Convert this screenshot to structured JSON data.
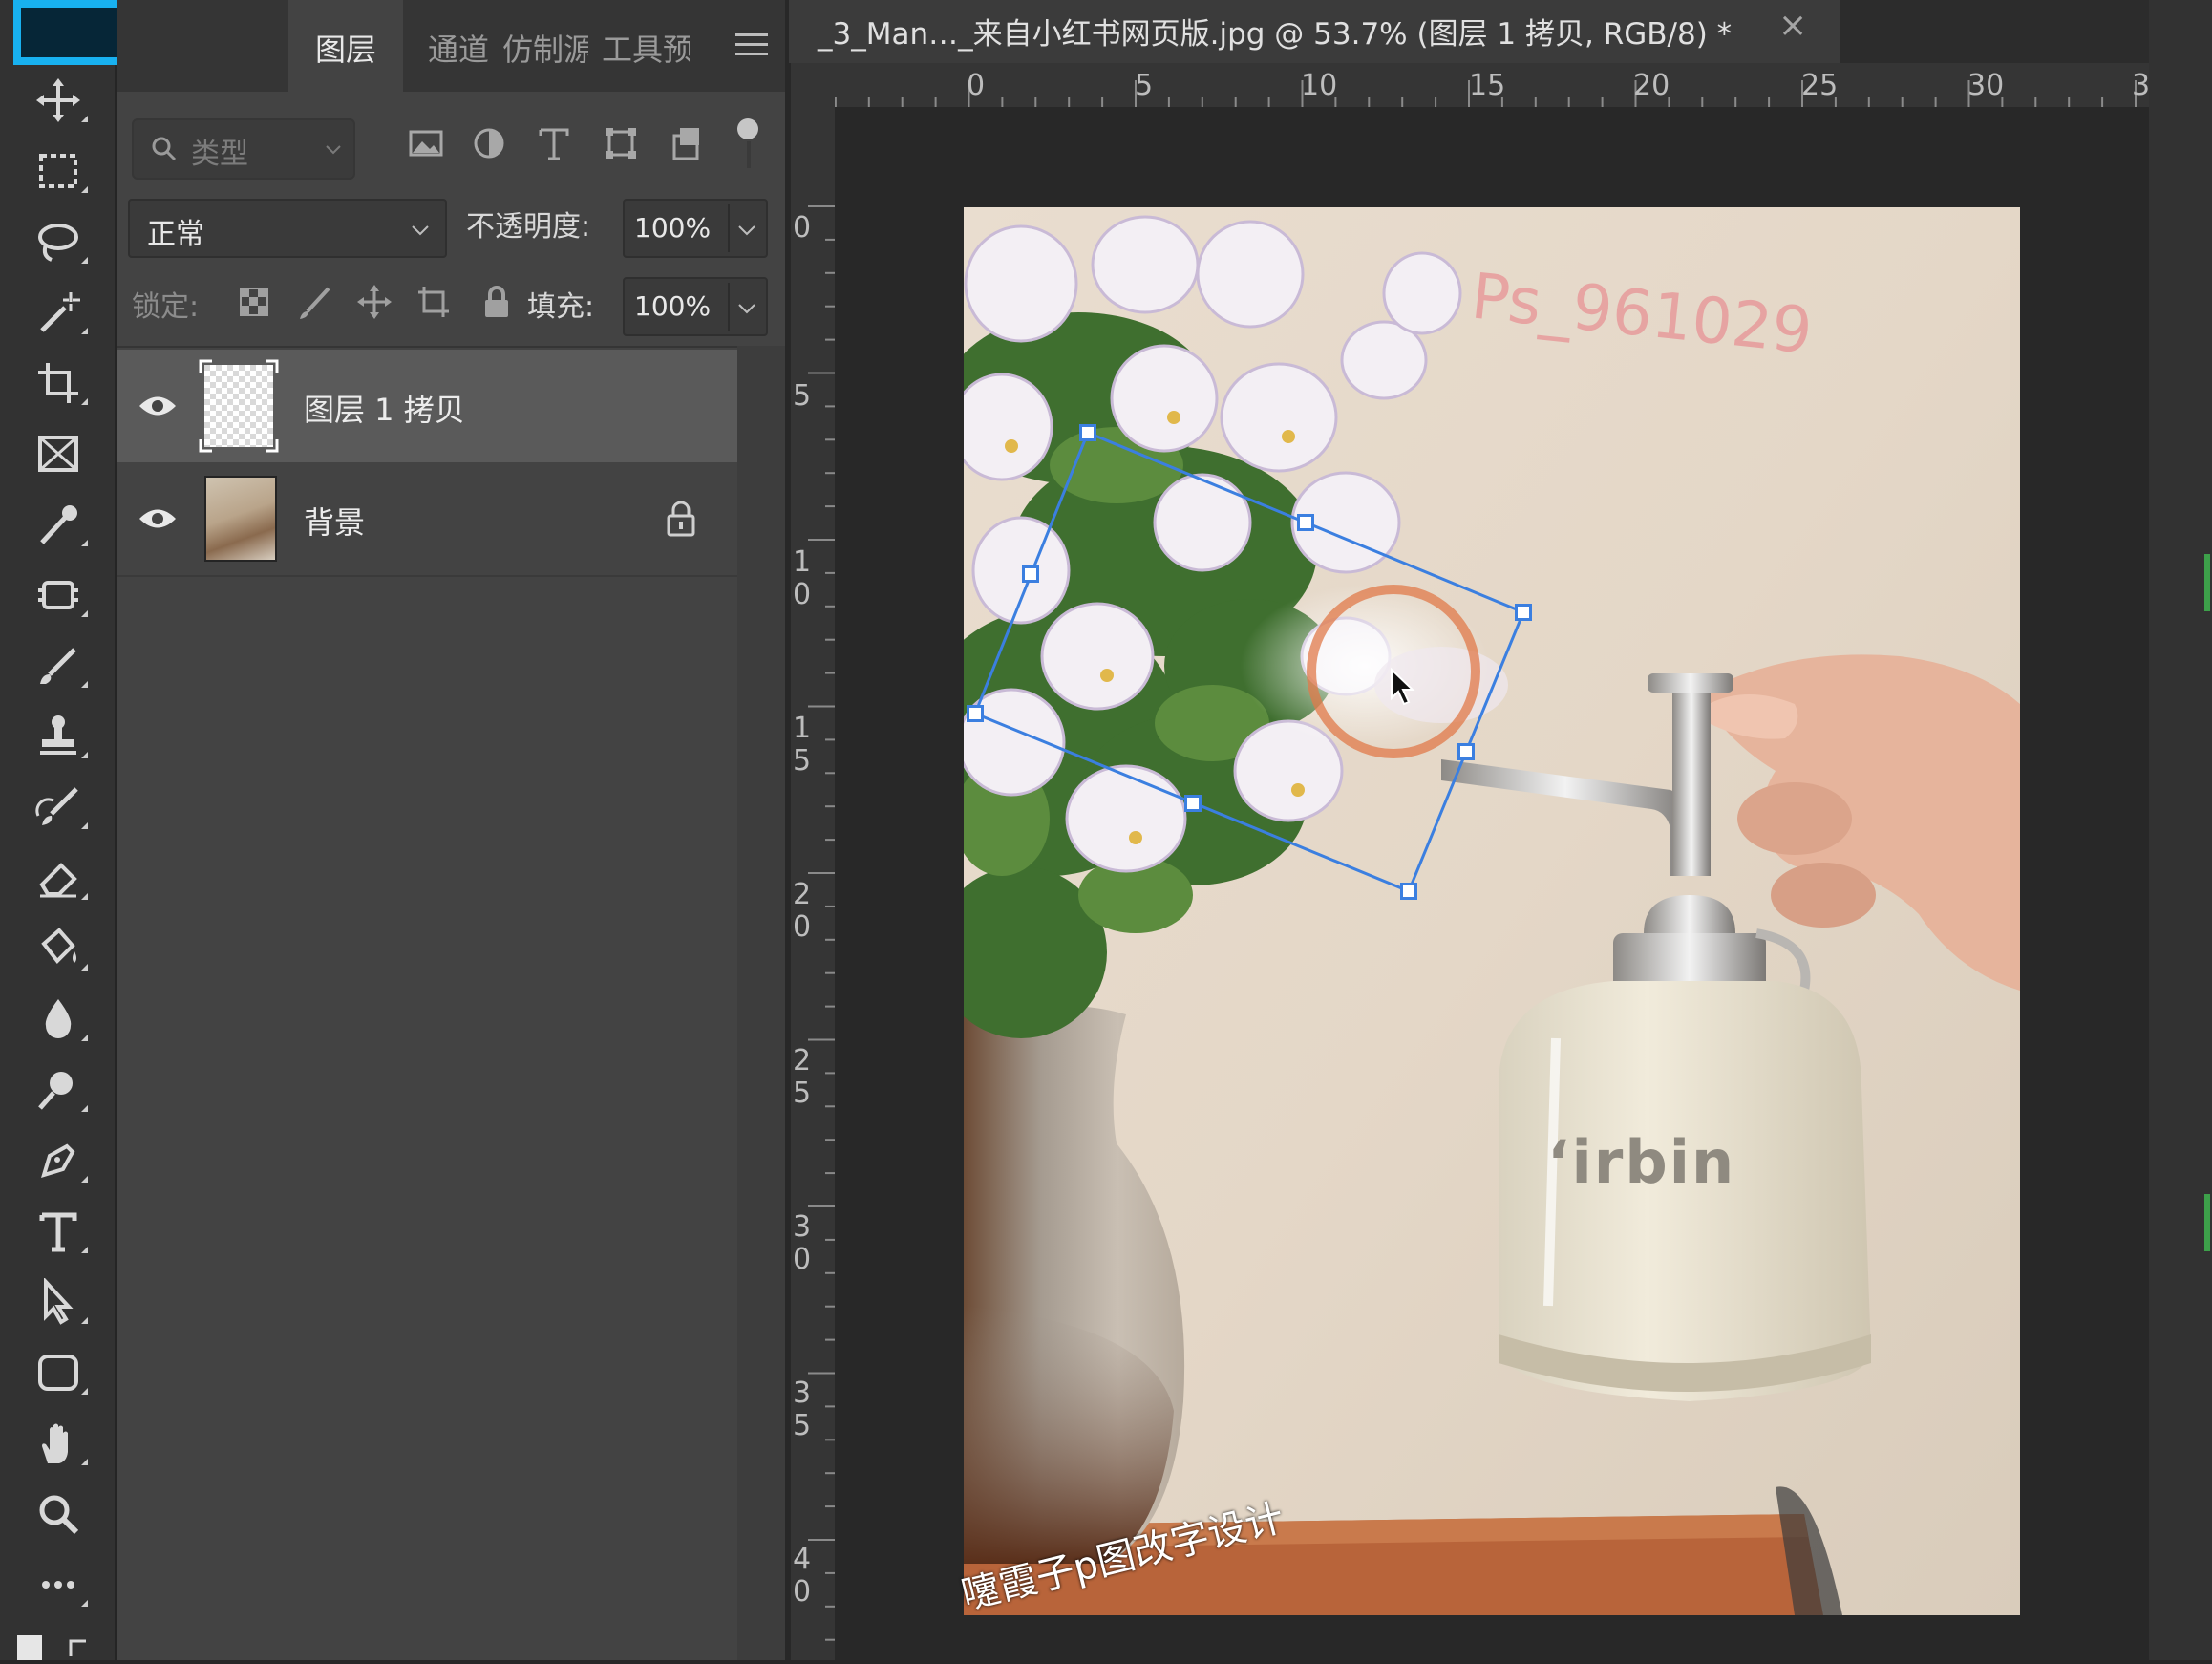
{
  "document": {
    "title": "_3_Man…_来自小红书网页版.jpg @ 53.7% (图层 1 拷贝, RGB/8) *",
    "close_icon": "×"
  },
  "colors": {
    "foreground_swatch_border": "#18b1f0",
    "foreground_swatch_fill": "#062637",
    "selection_handle": "#3b7fe0",
    "brush_cursor": "#e07a4a"
  },
  "panel": {
    "tabs": [
      {
        "label": "图层",
        "active": true
      },
      {
        "label": "通道",
        "active": false
      },
      {
        "label": "仿制源",
        "active": false
      },
      {
        "label": "工具预",
        "active": false
      }
    ],
    "search_placeholder": "类型",
    "blend_mode": "正常",
    "opacity_label": "不透明度:",
    "opacity_value": "100%",
    "lock_label": "锁定:",
    "fill_label": "填充:",
    "fill_value": "100%",
    "layers": [
      {
        "name": "图层 1 拷贝",
        "selected": true,
        "locked": false
      },
      {
        "name": "背景",
        "selected": false,
        "locked": true
      }
    ]
  },
  "tools": [
    "move-tool",
    "marquee-tool",
    "lasso-tool",
    "magic-wand-tool",
    "crop-tool",
    "frame-tool",
    "eyedropper-tool",
    "patch-tool",
    "brush-tool",
    "stamp-tool",
    "history-brush-tool",
    "eraser-tool",
    "paint-bucket-tool",
    "blur-tool",
    "dodge-tool",
    "pen-tool",
    "type-tool",
    "path-selection-tool",
    "shape-tool",
    "hand-tool",
    "zoom-tool",
    "more-tools"
  ],
  "ruler": {
    "top": [
      "0",
      "5",
      "10",
      "15",
      "20",
      "25",
      "30",
      "3"
    ],
    "left": [
      "0",
      "5",
      "1\n0",
      "1\n5",
      "2\n0",
      "2\n5",
      "3\n0",
      "3\n5",
      "4\n0"
    ]
  },
  "canvas": {
    "watermark_top": "Ps_961029",
    "brand": "‘irbin",
    "watermark_bottom": "嚔霞子p图改字设计"
  }
}
